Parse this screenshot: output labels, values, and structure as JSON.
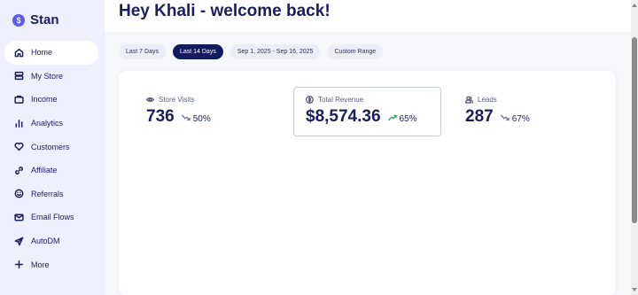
{
  "app": {
    "name": "Stan",
    "logo_glyph": "$"
  },
  "sidebar": {
    "items": [
      {
        "label": "Home",
        "icon": "home-icon",
        "active": true
      },
      {
        "label": "My Store",
        "icon": "store-icon",
        "active": false
      },
      {
        "label": "Income",
        "icon": "wallet-icon",
        "active": false
      },
      {
        "label": "Analytics",
        "icon": "bar-chart-icon",
        "active": false
      },
      {
        "label": "Customers",
        "icon": "heart-icon",
        "active": false
      },
      {
        "label": "Affiliate",
        "icon": "link-icon",
        "active": false
      },
      {
        "label": "Referrals",
        "icon": "smile-icon",
        "active": false
      },
      {
        "label": "Email Flows",
        "icon": "mail-icon",
        "active": false
      },
      {
        "label": "AutoDM",
        "icon": "send-icon",
        "active": false
      },
      {
        "label": "More",
        "icon": "plus-icon",
        "active": false
      }
    ]
  },
  "header": {
    "title": "Hey Khali - welcome back!"
  },
  "filters": [
    {
      "label": "Last 7 Days",
      "active": false
    },
    {
      "label": "Last 14 Days",
      "active": true
    },
    {
      "label": "Sep 1, 2025 - Sep 16, 2025",
      "active": false
    },
    {
      "label": "Custom Range",
      "active": false
    }
  ],
  "stats": {
    "visits": {
      "label": "Store Visits",
      "value": "736",
      "change": "50%",
      "trend": "down",
      "icon": "eye-icon"
    },
    "revenue": {
      "label": "Total Revenue",
      "value": "$8,574.36",
      "change": "65%",
      "trend": "up",
      "icon": "dollar-circle-icon"
    },
    "leads": {
      "label": "Leads",
      "value": "287",
      "change": "67%",
      "trend": "down",
      "icon": "users-icon"
    }
  },
  "colors": {
    "brand": "#5a5bf0",
    "navy": "#141a5c",
    "sidebar_bg": "#eef0ff",
    "trend_up": "#2f9e6a",
    "trend_down": "#6a7090"
  }
}
